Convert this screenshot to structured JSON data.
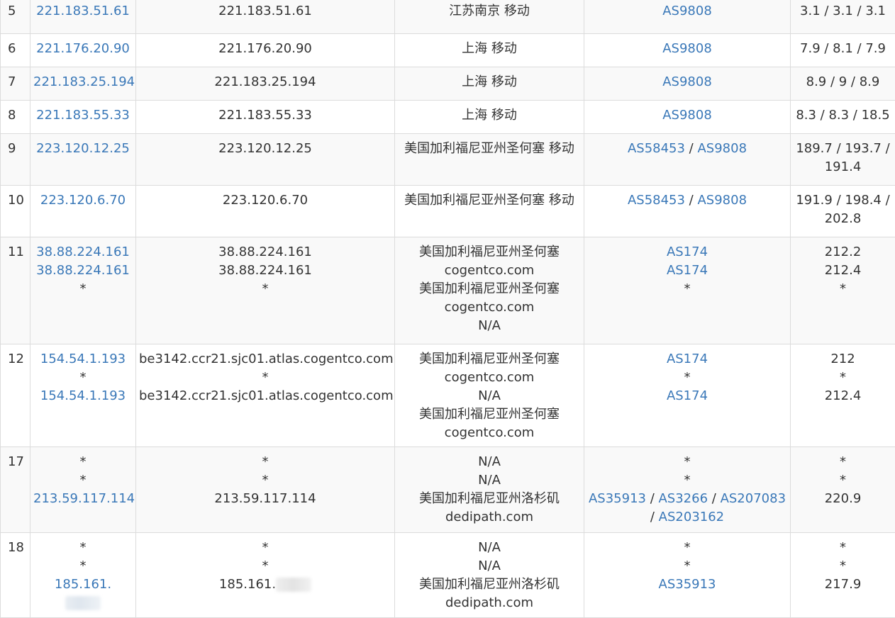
{
  "rows": [
    {
      "hop": "5",
      "ips": [
        "221.183.51.61"
      ],
      "hosts": [
        "221.183.51.61"
      ],
      "locations": [
        "江苏南京 移动"
      ],
      "asns": [
        [
          "AS9808"
        ]
      ],
      "latency": [
        "3.1 / 3.1 / 3.1"
      ]
    },
    {
      "hop": "6",
      "ips": [
        "221.176.20.90"
      ],
      "hosts": [
        "221.176.20.90"
      ],
      "locations": [
        "上海 移动"
      ],
      "asns": [
        [
          "AS9808"
        ]
      ],
      "latency": [
        "7.9 / 8.1 / 7.9"
      ]
    },
    {
      "hop": "7",
      "ips": [
        "221.183.25.194"
      ],
      "hosts": [
        "221.183.25.194"
      ],
      "locations": [
        "上海 移动"
      ],
      "asns": [
        [
          "AS9808"
        ]
      ],
      "latency": [
        "8.9 / 9 / 8.9"
      ]
    },
    {
      "hop": "8",
      "ips": [
        "221.183.55.33"
      ],
      "hosts": [
        "221.183.55.33"
      ],
      "locations": [
        "上海 移动"
      ],
      "asns": [
        [
          "AS9808"
        ]
      ],
      "latency": [
        "8.3 / 8.3 / 18.5"
      ]
    },
    {
      "hop": "9",
      "ips": [
        "223.120.12.25"
      ],
      "hosts": [
        "223.120.12.25"
      ],
      "locations": [
        "美国加利福尼亚州圣何塞 移动"
      ],
      "asns": [
        [
          "AS58453",
          "AS9808"
        ]
      ],
      "latency": [
        "189.7 / 193.7 /",
        "191.4"
      ]
    },
    {
      "hop": "10",
      "ips": [
        "223.120.6.70"
      ],
      "hosts": [
        "223.120.6.70"
      ],
      "locations": [
        "美国加利福尼亚州圣何塞 移动"
      ],
      "asns": [
        [
          "AS58453",
          "AS9808"
        ]
      ],
      "latency": [
        "191.9 / 198.4 /",
        "202.8"
      ]
    },
    {
      "hop": "11",
      "ips": [
        "38.88.224.161",
        "38.88.224.161",
        "*"
      ],
      "hosts": [
        "38.88.224.161",
        "38.88.224.161",
        "*"
      ],
      "locations": [
        "美国加利福尼亚州圣何塞",
        "cogentco.com",
        "美国加利福尼亚州圣何塞",
        "cogentco.com",
        "N/A"
      ],
      "asns": [
        [
          "AS174"
        ],
        [
          "AS174"
        ],
        "*"
      ],
      "latency": [
        "212.2",
        "212.4",
        "*"
      ]
    },
    {
      "hop": "12",
      "ips": [
        "154.54.1.193",
        "*",
        "154.54.1.193"
      ],
      "hosts": [
        "be3142.ccr21.sjc01.atlas.cogentco.com",
        "*",
        "be3142.ccr21.sjc01.atlas.cogentco.com"
      ],
      "locations": [
        "美国加利福尼亚州圣何塞",
        "cogentco.com",
        "N/A",
        "美国加利福尼亚州圣何塞",
        "cogentco.com"
      ],
      "asns": [
        [
          "AS174"
        ],
        "*",
        [
          "AS174"
        ]
      ],
      "latency": [
        "212",
        "*",
        "212.4"
      ]
    },
    {
      "hop": "17",
      "ips": [
        "*",
        "*",
        "213.59.117.114"
      ],
      "hosts": [
        "*",
        "*",
        "213.59.117.114"
      ],
      "locations": [
        "N/A",
        "N/A",
        "美国加利福尼亚州洛杉矶",
        "dedipath.com"
      ],
      "asns": [
        "*",
        "*",
        [
          "AS35913",
          "AS3266",
          "AS207083"
        ],
        [
          "AS203162"
        ]
      ],
      "latency": [
        "*",
        "*",
        "220.9"
      ]
    },
    {
      "hop": "18",
      "ips": [
        "*",
        "*",
        "185.161."
      ],
      "hosts": [
        "*",
        "*",
        "185.161."
      ],
      "locations": [
        "N/A",
        "N/A",
        "美国加利福尼亚州洛杉矶",
        "dedipath.com"
      ],
      "asns": [
        "*",
        "*",
        [
          "AS35913"
        ]
      ],
      "latency": [
        "*",
        "*",
        "217.9"
      ]
    }
  ]
}
